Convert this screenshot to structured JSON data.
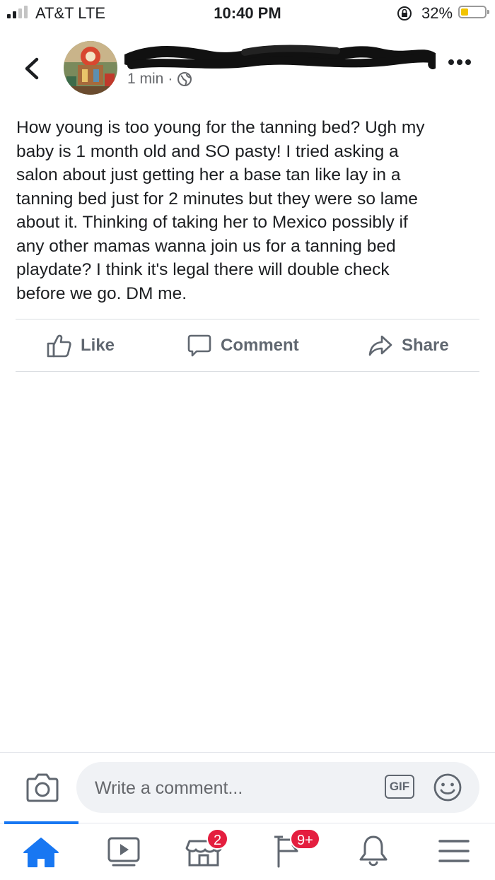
{
  "status_bar": {
    "carrier": "AT&T LTE",
    "time": "10:40 PM",
    "battery_percent": "32%",
    "battery_level": 0.32,
    "signal_bars_filled": 2,
    "signal_bars_total": 4
  },
  "header": {
    "timestamp": "1 min",
    "separator": "·",
    "privacy_icon": "globe-icon",
    "back_icon": "chevron-left-icon",
    "more_icon": "ellipsis-icon"
  },
  "post": {
    "text": "How young is too young for the tanning bed? Ugh my\nbaby is 1 month old and SO pasty! I tried asking a\nsalon about just getting her a base tan like lay in a\ntanning bed just for 2 minutes but they were so lame\nabout it. Thinking of taking her to Mexico possibly if\nany other mamas wanna join us for a tanning bed\nplaydate? I think it's legal there will double check\nbefore we go. DM me."
  },
  "actions": {
    "like": "Like",
    "comment": "Comment",
    "share": "Share"
  },
  "composer": {
    "placeholder": "Write a comment...",
    "gif_label": "GIF"
  },
  "tabs": {
    "marketplace_badge": "2",
    "pages_badge": "9+"
  },
  "colors": {
    "accent": "#1877f2",
    "badge": "#e41e3f",
    "battery": "#f2c400",
    "text": "#1c1e21",
    "muted": "#65676b"
  }
}
